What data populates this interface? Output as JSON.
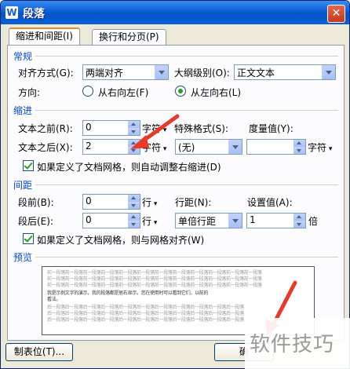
{
  "window": {
    "title": "段落",
    "app_icon": "W",
    "close_label": "✕"
  },
  "tabs": [
    {
      "label": "缩进和间距(I)",
      "active": true
    },
    {
      "label": "换行和分页(P)",
      "active": false
    }
  ],
  "general": {
    "section_label": "常规",
    "alignment_label": "对齐方式(G):",
    "alignment_value": "两端对齐",
    "outline_label": "大纲级别(O):",
    "outline_value": "正文文本",
    "direction_label": "方向:",
    "rtl_label": "从右向左(F)",
    "ltr_label": "从左向右(L)",
    "direction_selected": "ltr"
  },
  "indent": {
    "section_label": "缩进",
    "before_label": "文本之前(R):",
    "before_value": "0",
    "before_unit": "字符",
    "after_label": "文本之后(X):",
    "after_value": "2",
    "after_unit": "字符",
    "special_label": "特殊格式(S):",
    "special_value": "(无)",
    "measure_label": "度量值(Y):",
    "measure_value": "",
    "measure_unit": "字符",
    "grid_check_label": "如果定义了文档网格，则自动调整右缩进(D)",
    "grid_checked": true
  },
  "spacing": {
    "section_label": "间距",
    "before_label": "段前(B):",
    "before_value": "0",
    "before_unit": "行",
    "after_label": "段后(E):",
    "after_value": "0",
    "after_unit": "行",
    "line_label": "行距(N):",
    "line_value": "单倍行距",
    "setting_label": "设置值(A):",
    "setting_value": "1",
    "setting_unit": "倍",
    "grid_check_label": "如果定义了文档网格，则与网格对齐(W)",
    "grid_checked": true
  },
  "preview": {
    "section_label": "预览",
    "prev_line": "前一段落前一段落前一段落前一段落前一段落前一段落前一段落前一段落前一段落前一段落前一段落前一段落",
    "sample_line_1": "我是示例文字的演示，我的段落都是居右显示，您在使用时可以看到它们，以前的",
    "sample_line_2": "看法。",
    "next_line": "后一段落后一段落后一段落后一段落后一段落后一段落后一段落后一段落后一段落后一段落后一段落"
  },
  "buttons": {
    "tabs_label": "制表位(T)...",
    "ok_label": "确"
  },
  "watermark": {
    "text": "软件技巧"
  },
  "colors": {
    "accent": "#0046d5",
    "titlebar": "#0a5fd6",
    "annotation_arrow": "#e8392b"
  }
}
